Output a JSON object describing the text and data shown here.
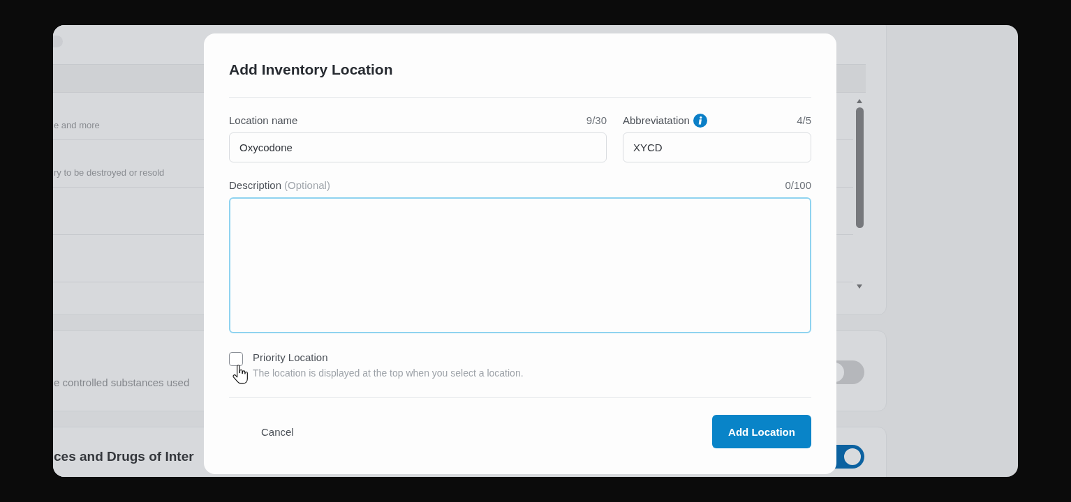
{
  "background": {
    "table_rows": [
      {
        "description": "e and more"
      },
      {
        "description": "ry to be destroyed or resold"
      }
    ],
    "settings": [
      {
        "kind": "description",
        "text": "e controlled substances used",
        "on": false
      },
      {
        "kind": "heading",
        "text": "ces and Drugs of Inter",
        "on": true
      }
    ]
  },
  "dialog": {
    "title": "Add Inventory Location",
    "fields": [
      {
        "label": "Location name",
        "info": false,
        "counter": "9/30",
        "value": "Oxycodone"
      },
      {
        "label": "Abbreviatation",
        "info": true,
        "counter": "4/5",
        "value": "XYCD"
      }
    ],
    "description": {
      "label": "Description",
      "hint": "(Optional)",
      "counter": "0/100",
      "focused": true
    },
    "priority": {
      "label": "Priority Location",
      "help": "The location is displayed at the top when you select a location.",
      "checked": false
    },
    "buttons": [
      {
        "label": "Cancel",
        "kind": "text"
      },
      {
        "label": "Add Location",
        "kind": "primary"
      }
    ]
  }
}
